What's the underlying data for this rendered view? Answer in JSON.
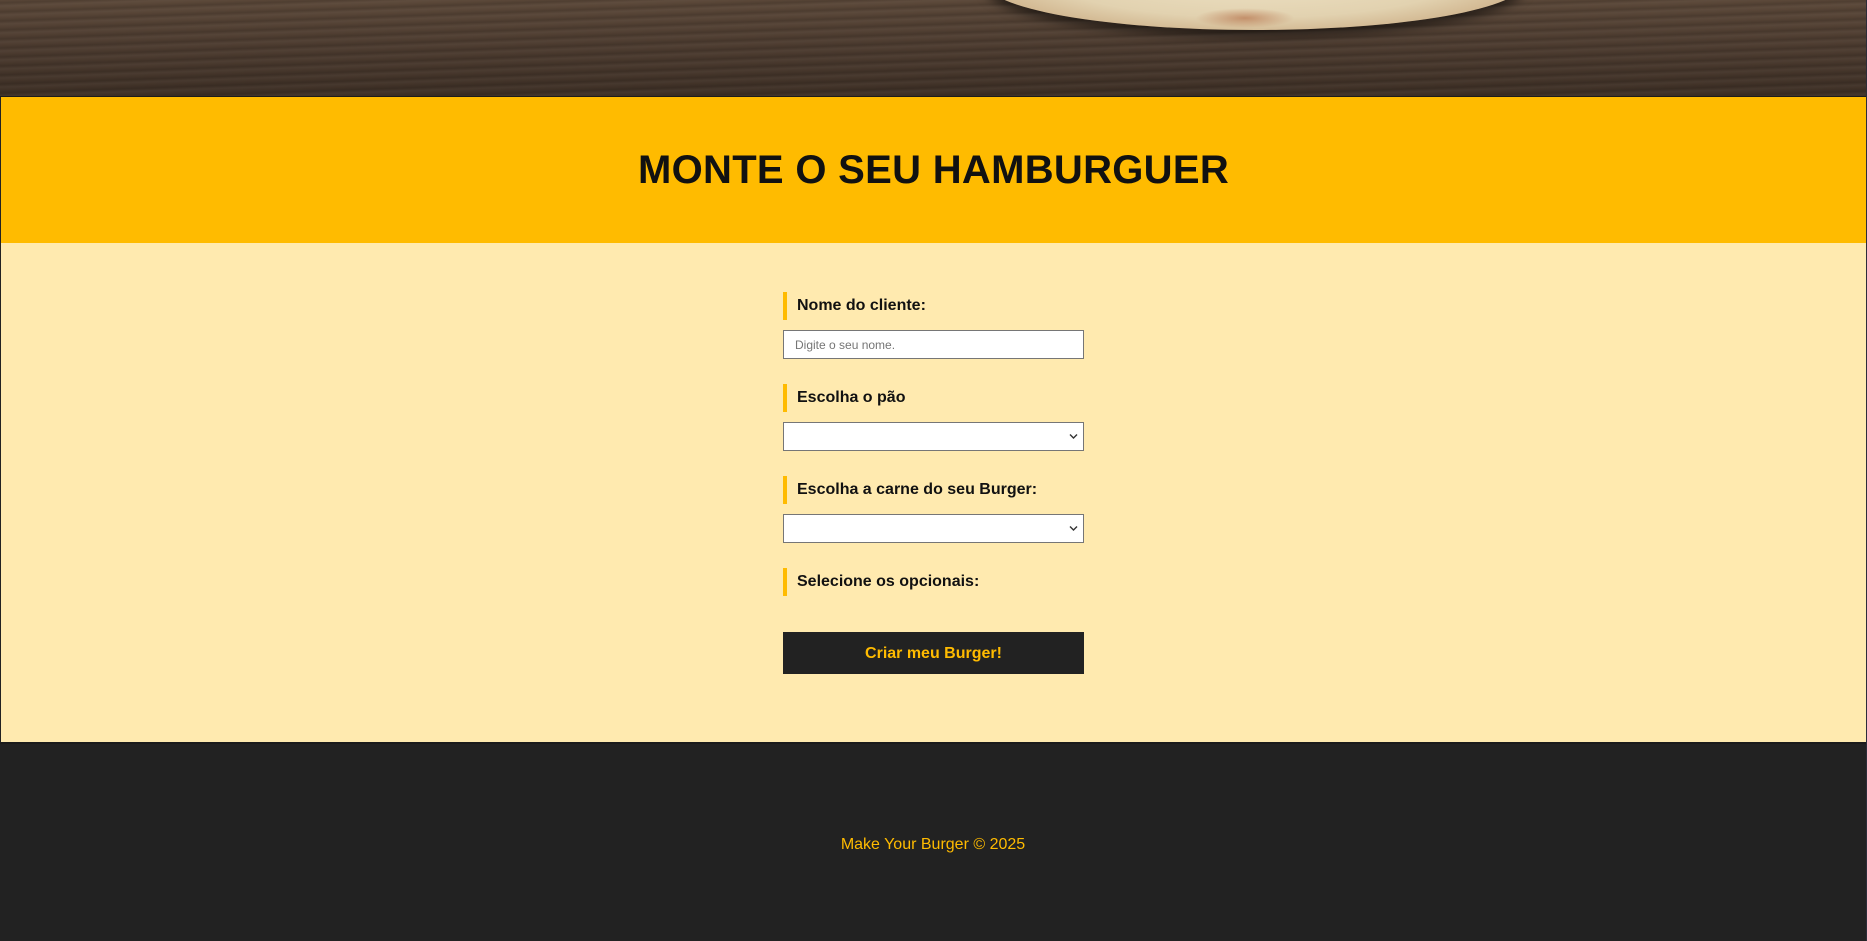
{
  "hero": {
    "image": "burger-on-wooden-board"
  },
  "page": {
    "title": "MONTE O SEU HAMBURGUER"
  },
  "form": {
    "name_label": "Nome do cliente:",
    "name_placeholder": "Digite o seu nome.",
    "name_value": "",
    "bread_label": "Escolha o pão",
    "bread_selected": "",
    "meat_label": "Escolha a carne do seu Burger:",
    "meat_selected": "",
    "optionals_label": "Selecione os opcionais:",
    "submit_label": "Criar meu Burger!"
  },
  "footer": {
    "text": "Make Your Burger © 2025"
  },
  "colors": {
    "accent": "#ffbb00",
    "form_background": "#ffeaaf",
    "dark": "#222222"
  },
  "icons": {
    "select_arrow": "chevron-down-icon"
  }
}
